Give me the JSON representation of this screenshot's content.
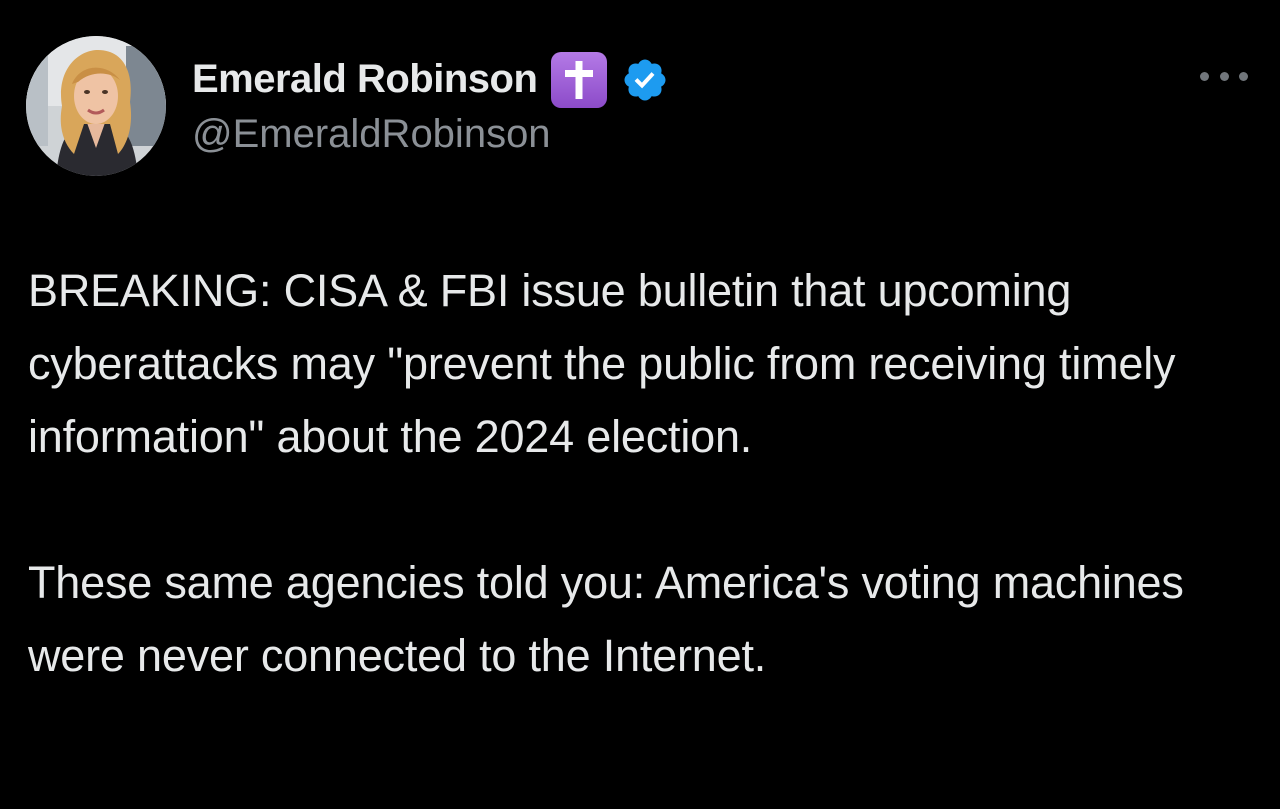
{
  "author": {
    "display_name": "Emerald Robinson",
    "handle": "@EmeraldRobinson",
    "name_emoji": "latin-cross-emoji",
    "verified_icon": "verified-badge-icon",
    "verified_color": "#1d9bf0"
  },
  "menu": {
    "icon": "more-options-icon"
  },
  "tweet": {
    "paragraphs": [
      "BREAKING: CISA & FBI issue bulletin that upcoming cyberattacks may \"prevent the public from receiving timely information\" about the 2024 election.",
      "These same agencies told you: America's voting machines were never connected to the Internet."
    ]
  },
  "colors": {
    "background": "#000000",
    "text": "#e7e9ea",
    "secondary_text": "#8b9096",
    "emoji_purple": "#9c5bd6"
  }
}
